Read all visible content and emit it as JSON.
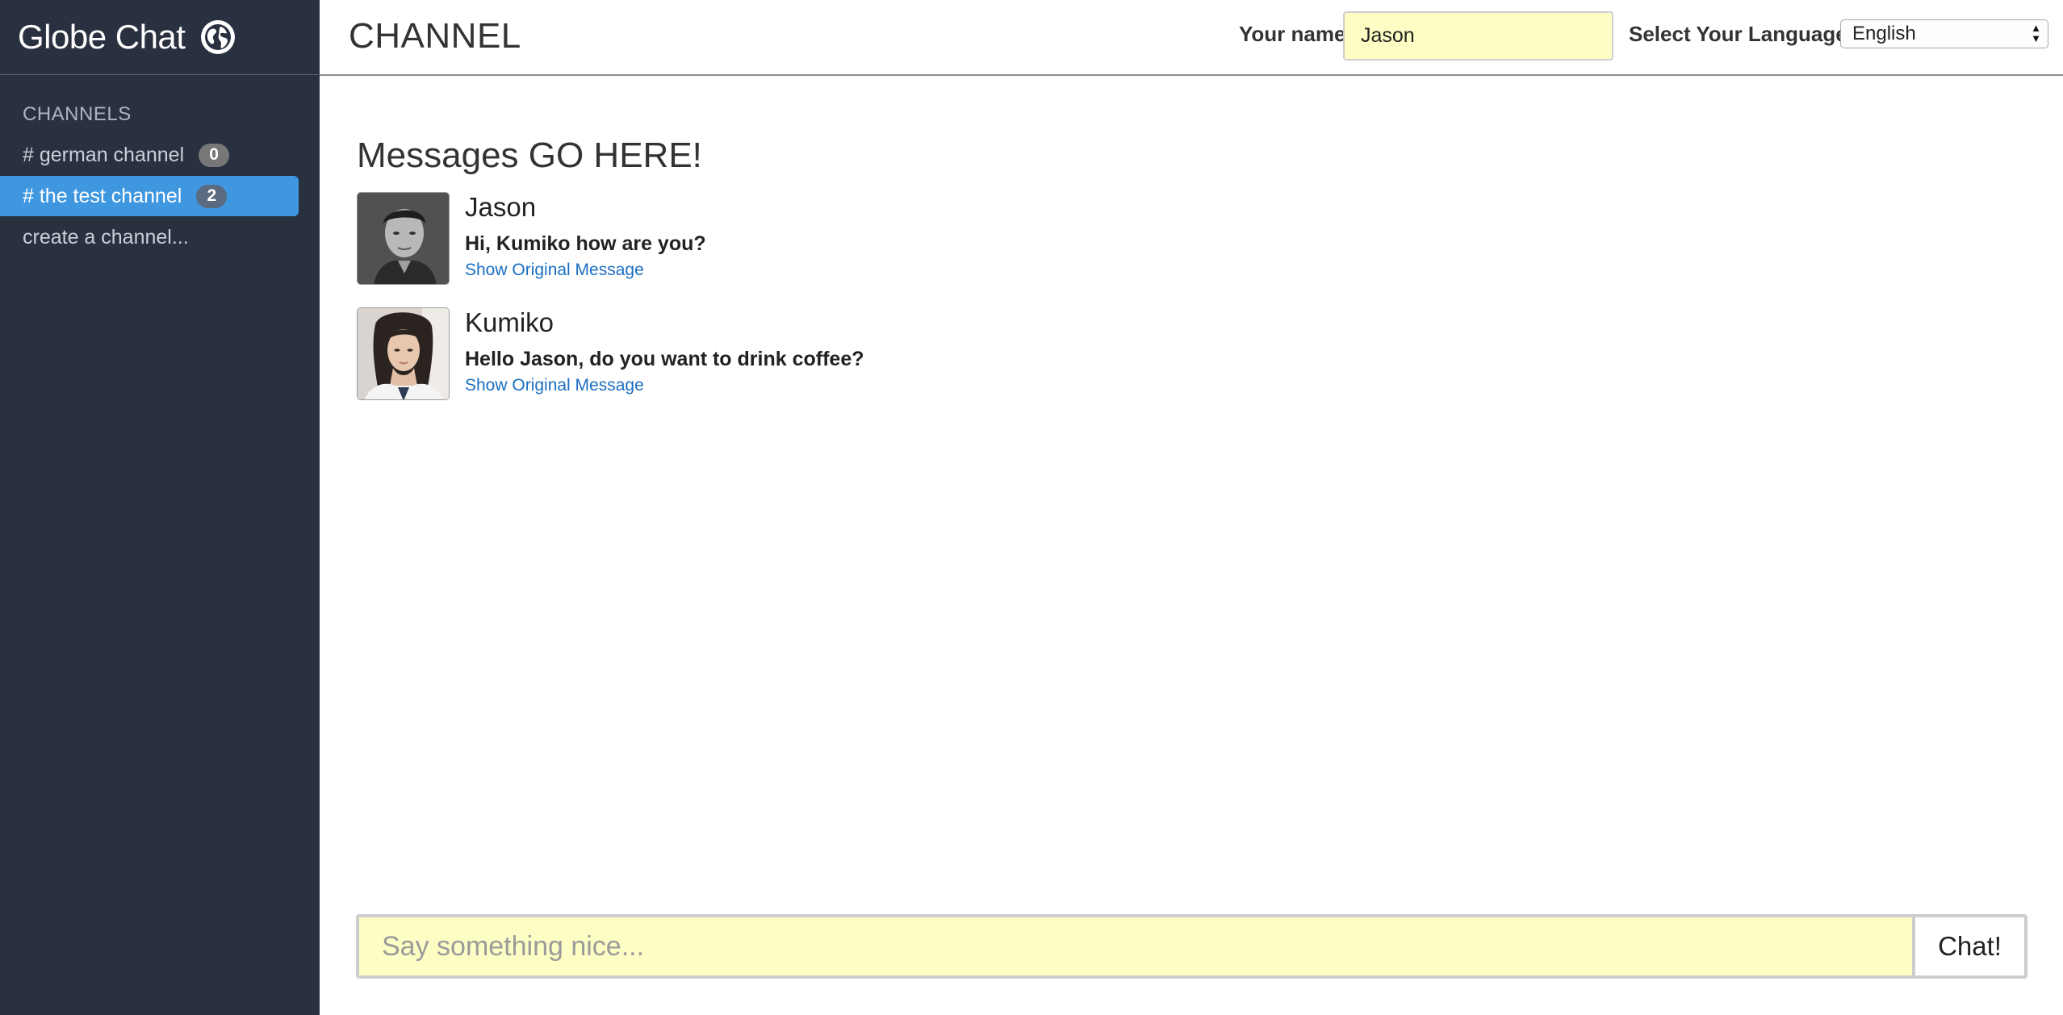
{
  "app": {
    "brand_title": "Globe Chat",
    "brand_icon": "globe-icon"
  },
  "sidebar": {
    "heading": "CHANNELS",
    "channels": [
      {
        "label": "# german channel",
        "count": "0",
        "active": false
      },
      {
        "label": "# the test channel",
        "count": "2",
        "active": true
      }
    ],
    "create_label": "create a channel..."
  },
  "header": {
    "title": "CHANNEL",
    "name_label": "Your name",
    "name_value": "Jason",
    "language_label": "Select Your Language",
    "language_selected": "English"
  },
  "messages": {
    "heading": "Messages GO HERE!",
    "items": [
      {
        "author": "Jason",
        "text": "Hi, Kumiko how are you?",
        "link": "Show Original Message"
      },
      {
        "author": "Kumiko",
        "text": "Hello Jason, do you want to drink coffee?",
        "link": "Show Original Message"
      }
    ]
  },
  "composer": {
    "placeholder": "Say something nice...",
    "button_label": "Chat!"
  },
  "colors": {
    "sidebar_bg": "#293140",
    "active_channel": "#3f97e0",
    "input_highlight": "#fdfec4",
    "link": "#1a6ec2"
  }
}
